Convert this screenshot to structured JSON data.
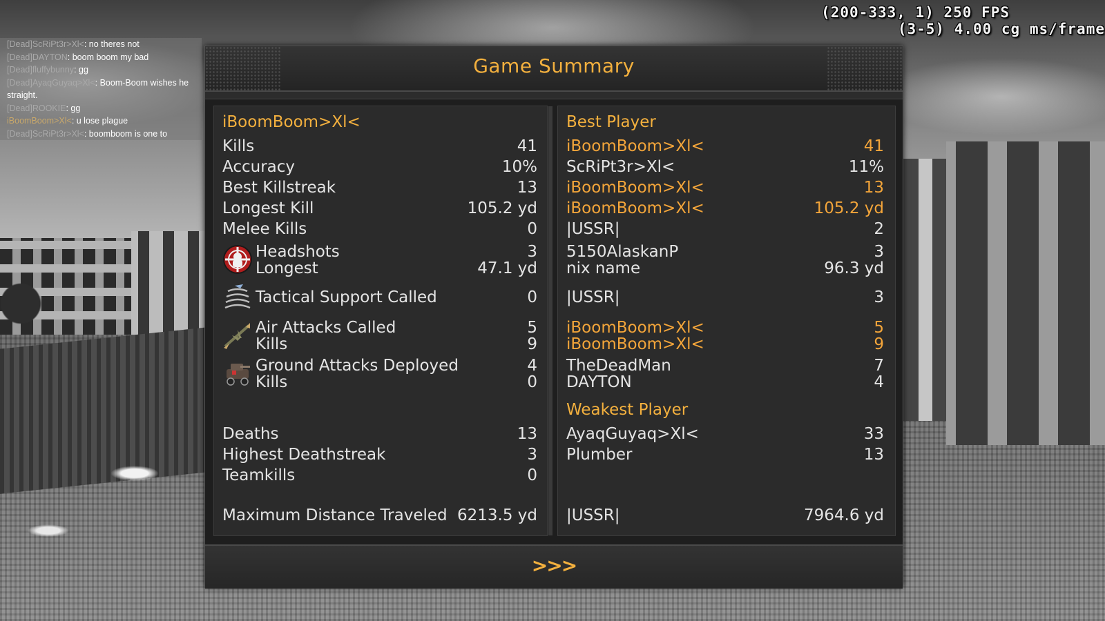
{
  "hud": {
    "perf_line1": "(200-333, 1) 250 FPS",
    "perf_line2": "(3-5) 4.00 cg ms/frame"
  },
  "chat": [
    {
      "speaker": "[Dead]ScRiPt3r>Xl<",
      "message": ": no theres not"
    },
    {
      "speaker": "[Dead]DAYTON",
      "message": ": boom boom my bad"
    },
    {
      "speaker": "[Dead]fluffybunny",
      "message": ": gg"
    },
    {
      "speaker": "[Dead]AyaqGuyaq>Xl<",
      "message": ": Boom-Boom wishes he straight."
    },
    {
      "speaker": "[Dead]ROOKIE",
      "message": ": gg"
    },
    {
      "speaker": "iBoomBoom>Xl<",
      "message": ": u lose plague"
    },
    {
      "speaker": "[Dead]ScRiPt3r>Xl<",
      "message": ": boomboom is one to"
    }
  ],
  "summary": {
    "title": "Game Summary",
    "next_label": ">>>",
    "player_name": "iBoomBoom>Xl<",
    "best_header": "Best Player",
    "weakest_header": "Weakest Player",
    "stats": {
      "kills": {
        "label": "Kills",
        "value": "41",
        "best": "iBoomBoom>Xl<",
        "best_value": "41"
      },
      "accuracy": {
        "label": "Accuracy",
        "value": "10%",
        "best": "ScRiPt3r>Xl<",
        "best_value": "11%"
      },
      "killstreak": {
        "label": "Best Killstreak",
        "value": "13",
        "best": "iBoomBoom>Xl<",
        "best_value": "13"
      },
      "longest_kill": {
        "label": "Longest Kill",
        "value": "105.2 yd",
        "best": "iBoomBoom>Xl<",
        "best_value": "105.2 yd"
      },
      "melee": {
        "label": "Melee Kills",
        "value": "0",
        "best": "|USSR|",
        "best_value": "2"
      },
      "headshots": {
        "label": "Headshots",
        "value": "3",
        "best": "5150AlaskanP",
        "best_value": "3"
      },
      "hs_longest": {
        "label": "Longest",
        "value": "47.1 yd",
        "best": "nix name",
        "best_value": "96.3 yd"
      },
      "tactical": {
        "label": "Tactical Support Called",
        "value": "0",
        "best": "|USSR|",
        "best_value": "3"
      },
      "air_called": {
        "label": "Air Attacks Called",
        "value": "5",
        "best": "iBoomBoom>Xl<",
        "best_value": "5"
      },
      "air_kills": {
        "label": "Kills",
        "value": "9",
        "best": "iBoomBoom>Xl<",
        "best_value": "9"
      },
      "ground_deployed": {
        "label": "Ground Attacks Deployed",
        "value": "4",
        "best": "TheDeadMan",
        "best_value": "7"
      },
      "ground_kills": {
        "label": "Kills",
        "value": "0",
        "best": "DAYTON",
        "best_value": "4"
      },
      "deaths": {
        "label": "Deaths",
        "value": "13",
        "worst": "AyaqGuyaq>Xl<",
        "worst_value": "33"
      },
      "deathstreak": {
        "label": "Highest Deathstreak",
        "value": "3",
        "worst": "Plumber",
        "worst_value": "13"
      },
      "teamkills": {
        "label": "Teamkills",
        "value": "0"
      },
      "distance": {
        "label": "Maximum Distance Traveled",
        "value": "6213.5 yd",
        "best": "|USSR|",
        "best_value": "7964.6 yd"
      }
    }
  },
  "icons": [
    "headshot-target-icon",
    "tactical-support-icon",
    "air-attack-icon",
    "ground-attack-icon"
  ],
  "colors": {
    "accent": "#f3b03e",
    "panel_bg": "#2b2b2b",
    "text": "#e4e4e4"
  }
}
